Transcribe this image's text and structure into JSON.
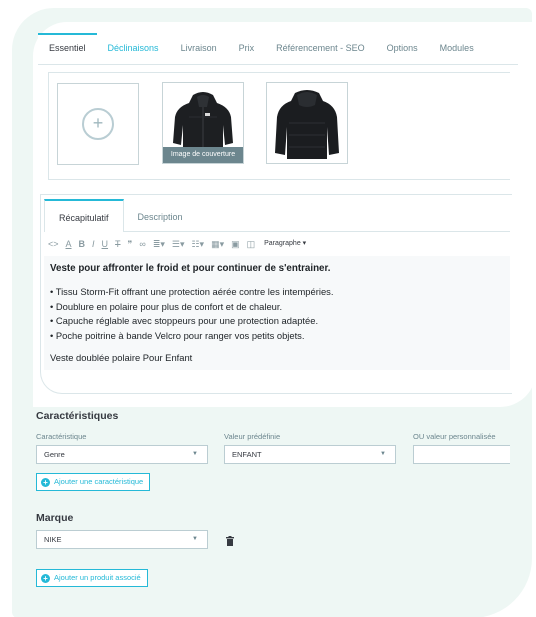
{
  "tabs": [
    {
      "label": "Essentiel"
    },
    {
      "label": "Déclinaisons"
    },
    {
      "label": "Livraison"
    },
    {
      "label": "Prix"
    },
    {
      "label": "Référencement - SEO"
    },
    {
      "label": "Options"
    },
    {
      "label": "Modules"
    }
  ],
  "images": {
    "cover_label": "Image de couverture"
  },
  "editor": {
    "tabs": [
      "Récapitulatif",
      "Description"
    ],
    "format_label": "Paragraphe ▾",
    "headline": "Veste pour affronter le froid et pour continuer de s'entrainer.",
    "bullets": [
      "• Tissu Storm-Fit offrant une protection aérée contre les intempéries.",
      "• Doublure en polaire pour plus de confort et de chaleur.",
      "• Capuche réglable avec stoppeurs pour une protection adaptée.",
      "• Poche poitrine à bande Velcro pour ranger vos petits objets."
    ],
    "tail": "Veste doublée polaire Pour Enfant"
  },
  "features": {
    "title": "Caractéristiques",
    "col_feature": "Caractéristique",
    "col_value": "Valeur prédéfinie",
    "col_custom": "OU valeur personnalisée",
    "feature_value": "Genre",
    "predefined_value": "ENFANT",
    "add_button": "Ajouter une caractéristique"
  },
  "brand": {
    "title": "Marque",
    "value": "NIKE",
    "add_related_button": "Ajouter un produit associé"
  },
  "colors": {
    "accent": "#25b9d7",
    "background_blob": "#eef7f4"
  }
}
